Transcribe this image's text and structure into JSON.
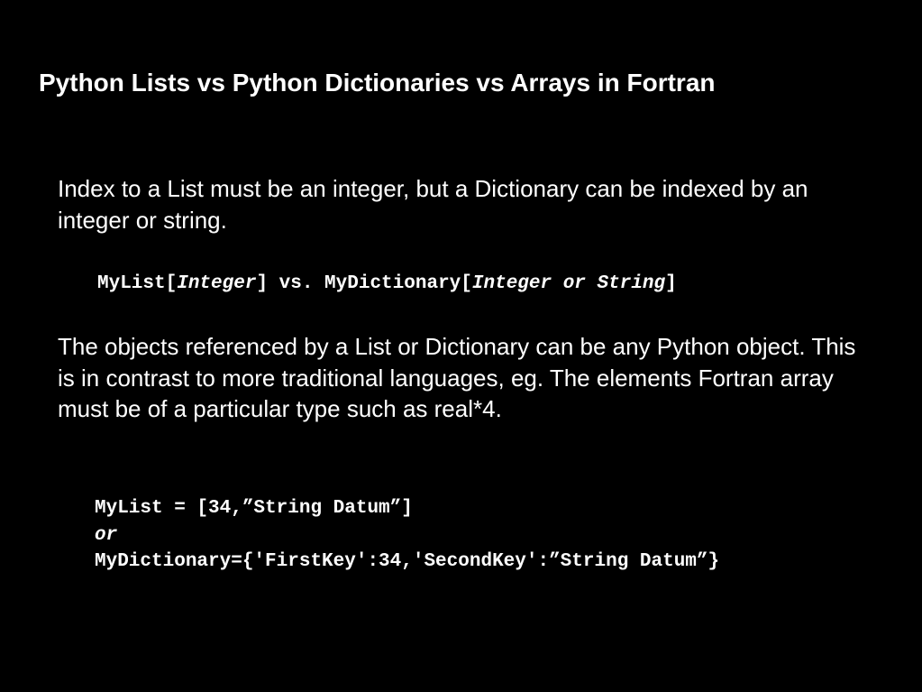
{
  "slide": {
    "title": "Python Lists vs Python Dictionaries vs Arrays in Fortran",
    "paragraph1": "Index to a List must be an integer, but a Dictionary can be indexed by an integer or string.",
    "code1": {
      "prefix": "MyList[",
      "arg1": "Integer",
      "middle": "] vs. MyDictionary[",
      "arg2": "Integer or String",
      "suffix": "]"
    },
    "paragraph2": "The objects referenced by a List or Dictionary can be any Python object.  This is in contrast to more traditional languages, eg. The elements Fortran array  must be of a particular type such as real*4.",
    "code2": {
      "line1": "MyList = [34,”String Datum”]",
      "line2": "or",
      "line3": "MyDictionary={'FirstKey':34,'SecondKey':”String Datum”}"
    }
  },
  "colors": {
    "background": "#000000",
    "text": "#ffffff"
  }
}
